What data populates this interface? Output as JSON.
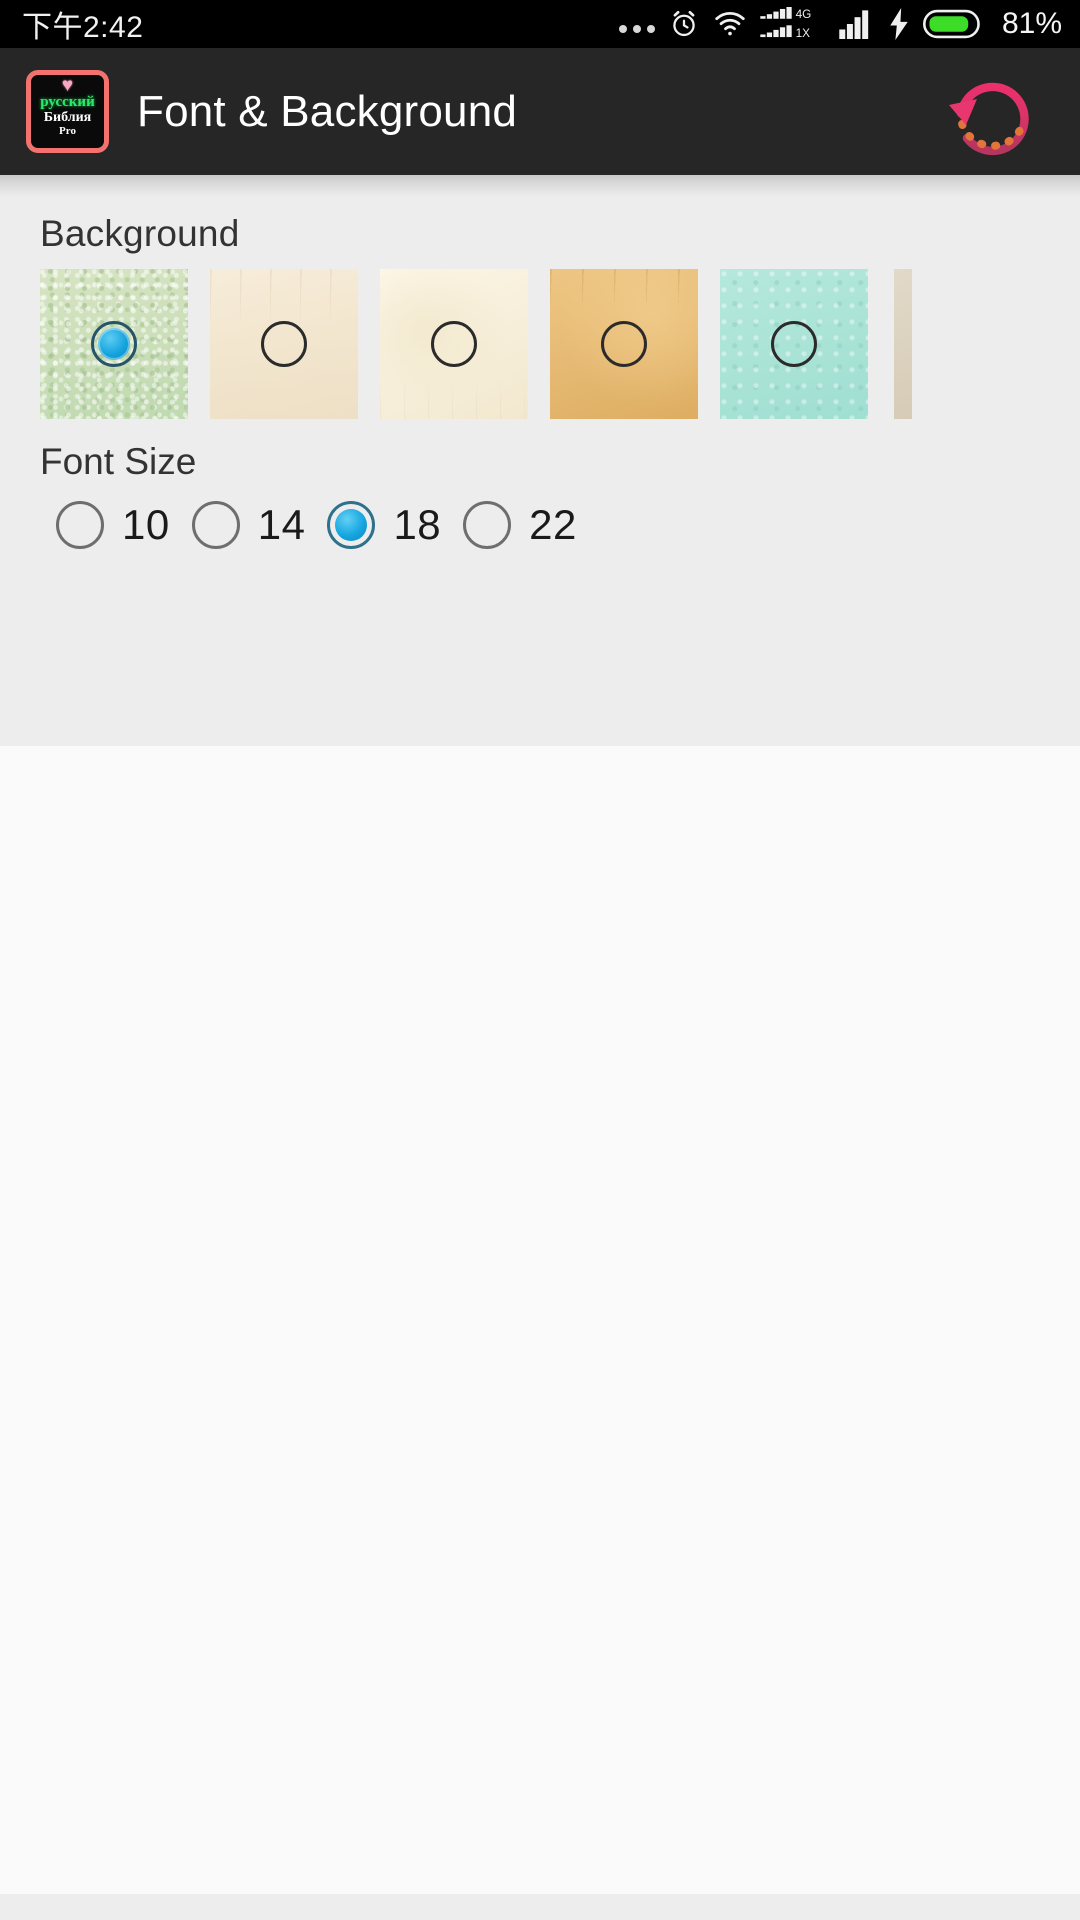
{
  "status_bar": {
    "time": "下午2:42",
    "battery_text": "81%",
    "icons": [
      {
        "name": "more-dots-icon"
      },
      {
        "name": "alarm-clock-icon"
      },
      {
        "name": "wifi-icon"
      },
      {
        "name": "signal-4g-1x-icon",
        "label_top": "4G",
        "label_bottom": "1X"
      },
      {
        "name": "signal-bars-icon"
      },
      {
        "name": "charging-bolt-icon"
      },
      {
        "name": "battery-icon"
      }
    ],
    "background_color": "#000000",
    "text_color": "#f2f2f2",
    "battery_color": "#3ddc28"
  },
  "app_bar": {
    "title": "Font & Background",
    "background_color": "#262626",
    "icon": {
      "name": "app-logo-icon",
      "heart": "♥",
      "line1": "русский",
      "line2": "Библия",
      "line3": "Pro",
      "border_color": "#f4726e",
      "line1_color": "#2ee86a"
    },
    "refresh": {
      "name": "refresh-icon",
      "color": "#e0336a",
      "accent_color": "#f08a33"
    }
  },
  "main": {
    "background_section": {
      "label": "Background",
      "swatches": [
        {
          "name": "background-swatch-green-speckle",
          "selected": true,
          "color": "#c3ddbb"
        },
        {
          "name": "background-swatch-cream",
          "selected": false,
          "color": "#f2e4cf"
        },
        {
          "name": "background-swatch-ivory",
          "selected": false,
          "color": "#f7efdc"
        },
        {
          "name": "background-swatch-tan",
          "selected": false,
          "color": "#e8bd72"
        },
        {
          "name": "background-swatch-mint",
          "selected": false,
          "color": "#a8e2d6"
        },
        {
          "name": "background-swatch-partial",
          "selected": false,
          "color": "#ded6c8"
        }
      ]
    },
    "font_size_section": {
      "label": "Font Size",
      "options": [
        {
          "value": "10",
          "selected": false
        },
        {
          "value": "14",
          "selected": false
        },
        {
          "value": "18",
          "selected": true
        },
        {
          "value": "22",
          "selected": false
        }
      ]
    }
  }
}
